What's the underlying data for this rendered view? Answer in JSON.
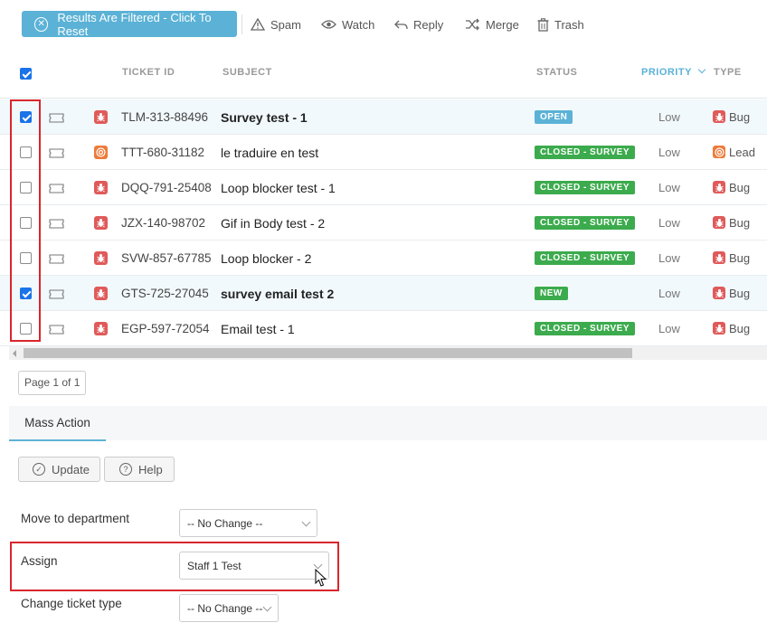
{
  "toolbar": {
    "filter_label": "Results Are Filtered - Click To Reset",
    "spam": "Spam",
    "watch": "Watch",
    "reply": "Reply",
    "merge": "Merge",
    "trash": "Trash"
  },
  "table": {
    "headers": {
      "ticket_id": "TICKET ID",
      "subject": "SUBJECT",
      "status": "STATUS",
      "priority": "PRIORITY",
      "type": "TYPE"
    },
    "rows": [
      {
        "checked": true,
        "id": "TLM-313-88496",
        "subject": "Survey test - 1",
        "status": "OPEN",
        "status_kind": "open",
        "priority": "Low",
        "type": "Bug",
        "type_kind": "bug",
        "bold": true
      },
      {
        "checked": false,
        "id": "TTT-680-31182",
        "subject": "le traduire en test",
        "status": "CLOSED - SURVEY",
        "status_kind": "closed",
        "priority": "Low",
        "type": "Lead",
        "type_kind": "lead",
        "bold": false
      },
      {
        "checked": false,
        "id": "DQQ-791-25408",
        "subject": "Loop blocker test - 1",
        "status": "CLOSED - SURVEY",
        "status_kind": "closed",
        "priority": "Low",
        "type": "Bug",
        "type_kind": "bug",
        "bold": false
      },
      {
        "checked": false,
        "id": "JZX-140-98702",
        "subject": "Gif in Body test - 2",
        "status": "CLOSED - SURVEY",
        "status_kind": "closed",
        "priority": "Low",
        "type": "Bug",
        "type_kind": "bug",
        "bold": false
      },
      {
        "checked": false,
        "id": "SVW-857-67785",
        "subject": "Loop blocker - 2",
        "status": "CLOSED - SURVEY",
        "status_kind": "closed",
        "priority": "Low",
        "type": "Bug",
        "type_kind": "bug",
        "bold": false
      },
      {
        "checked": true,
        "id": "GTS-725-27045",
        "subject": "survey email test 2",
        "status": "NEW",
        "status_kind": "new",
        "priority": "Low",
        "type": "Bug",
        "type_kind": "bug",
        "bold": true
      },
      {
        "checked": false,
        "id": "EGP-597-72054",
        "subject": "Email test - 1",
        "status": "CLOSED - SURVEY",
        "status_kind": "closed",
        "priority": "Low",
        "type": "Bug",
        "type_kind": "bug",
        "bold": false
      }
    ]
  },
  "pager": "Page 1 of 1",
  "mass_action": {
    "tab": "Mass Action",
    "update": "Update",
    "help": "Help",
    "fields": {
      "department_label": "Move to department",
      "department_value": "-- No Change --",
      "assign_label": "Assign",
      "assign_value": "Staff 1 Test",
      "type_label": "Change ticket type",
      "type_value": "-- No Change --"
    }
  },
  "colors": {
    "accent": "#5bb2d6",
    "status_green": "#3cab4d",
    "bug_red": "#e05a5a",
    "lead_orange": "#ee7a3a",
    "highlight_red": "#d9262c"
  }
}
